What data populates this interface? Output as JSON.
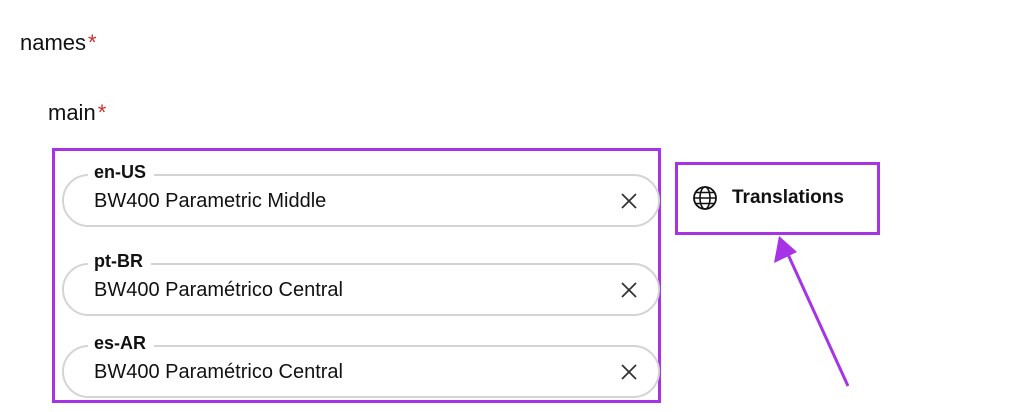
{
  "form": {
    "names_label": "names",
    "main_label": "main",
    "required_marker": "*"
  },
  "fields": [
    {
      "locale": "en-US",
      "value": "BW400 Parametric Middle"
    },
    {
      "locale": "pt-BR",
      "value": "BW400 Paramétrico Central"
    },
    {
      "locale": "es-AR",
      "value": "BW400 Paramétrico Central"
    }
  ],
  "translations_button": {
    "label": "Translations",
    "icon": "globe-icon"
  },
  "colors": {
    "annotation": "#a633e6",
    "required": "#d22d2d",
    "field_border": "#d4d4d4",
    "text": "#111111"
  },
  "icons": {
    "clear": "close-icon",
    "globe": "globe-icon",
    "annotation_arrow": "arrow-icon"
  }
}
